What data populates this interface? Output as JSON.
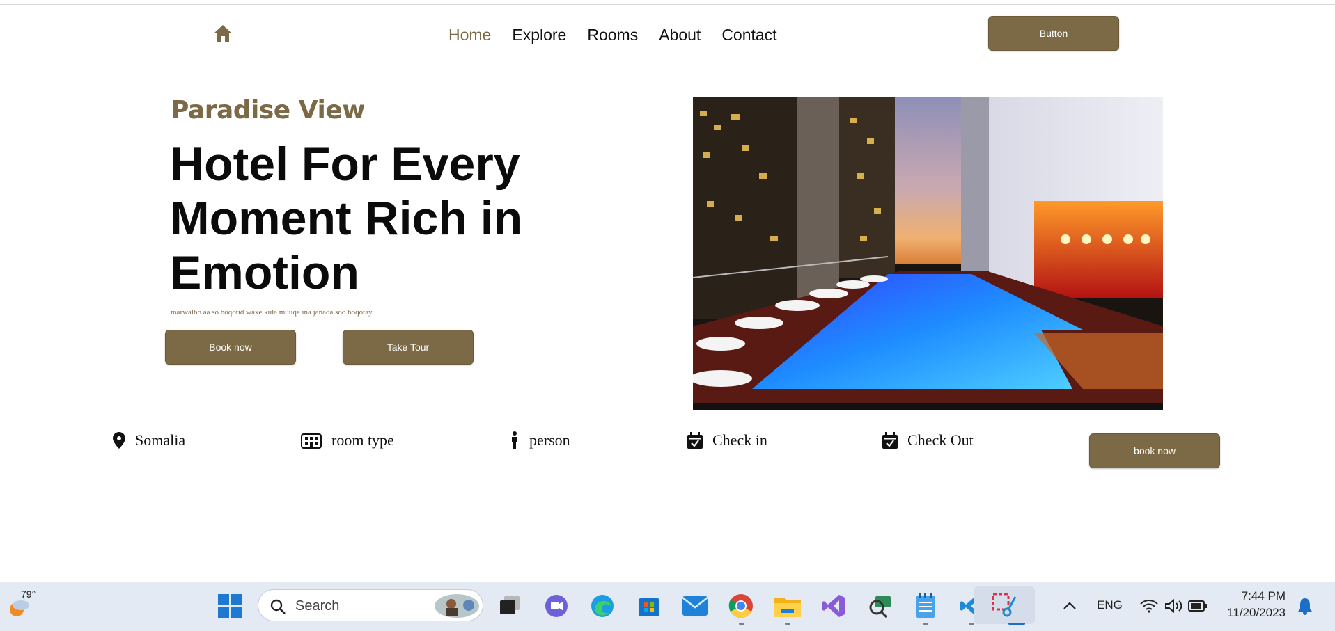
{
  "nav": {
    "links": [
      {
        "label": "Home",
        "active": true
      },
      {
        "label": "Explore"
      },
      {
        "label": "Rooms"
      },
      {
        "label": "About"
      },
      {
        "label": "Contact"
      }
    ],
    "button_label": "Button",
    "home_icon": "home-icon"
  },
  "hero": {
    "brand": "Paradise View",
    "headline": "Hotel For Every Moment Rich in Emotion",
    "subtext": "marwalbo aa so boqotid waxe kula muuqe ina janada soo boqotay",
    "book_label": "Book now",
    "tour_label": "Take Tour",
    "image_icon": "hotel-pool-photo"
  },
  "search": {
    "location": "Somalia",
    "room_type": "room type",
    "person": "person",
    "check_in": "Check in",
    "check_out": "Check Out",
    "button_label": "book now"
  },
  "taskbar": {
    "weather": "79°",
    "search_placeholder": "Search",
    "language": "ENG",
    "time": "7:44 PM",
    "date": "11/20/2023"
  },
  "colors": {
    "accent": "#7c6a46",
    "text": "#0b0b0b",
    "taskbar": "#e3eaf3"
  }
}
